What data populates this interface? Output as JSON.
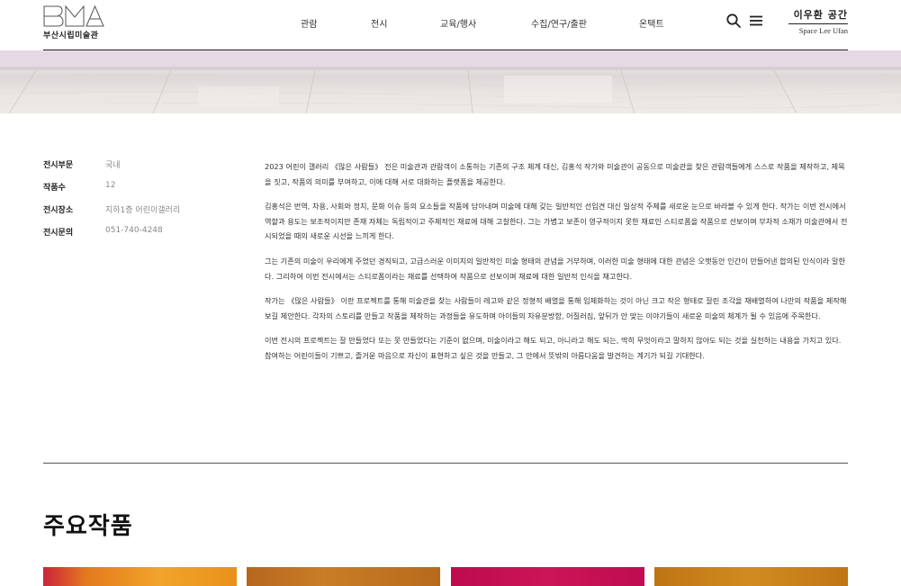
{
  "header": {
    "logo_text": "부산시립미술관",
    "logo_mark_letters": "BMA",
    "nav": [
      "관람",
      "전시",
      "교육/행사",
      "수집/연구/출판",
      "온택트"
    ],
    "search_icon": "search-icon",
    "menu_icon": "hamburger-menu-icon",
    "space_link_ko": "이우환 공간",
    "space_link_en": "Space Lee Ufan"
  },
  "exhibition_info": [
    {
      "label": "전시부문",
      "value": "국내"
    },
    {
      "label": "작품수",
      "value": "12"
    },
    {
      "label": "전시장소",
      "value": "지하1층 어린이갤러리"
    },
    {
      "label": "전시문의",
      "value": "051-740-4248"
    }
  ],
  "description": [
    "2023 어린이 갤러리 《많은 사람들》 전은 미술관과 관람객이 소통하는 기존의 구조 체계 대신, 김홍석 작가와 미술관이 공동으로 미술관을 찾은 관람객들에게 스스로 작품을 제작하고, 제목을 짓고, 작품의 의미를 부여하고, 이에 대해 서로 대화하는 플랫폼을 제공한다.",
    "김홍석은 번역, 차용, 사회와 정치, 문화 이슈 등의 요소들을 작품에 담아내며 미술에 대해 갖는 일반적인 선입견 대신 일상적 주제를 새로운 눈으로 바라볼 수 있게 한다. 작가는 이번 전시에서 역할과 용도는 보조적이지만 존재 자체는 독립적이고 주체적인 재료에 대해 고찰한다. 그는 가볍고 보존이 영구적이지 못한 재료인 스티로폼을 작품으로 선보이며 부차적 소재가 미술관에서 전시되었을 때의 새로운 시선을 느끼게 한다.",
    "그는 기존의 미술이 우리에게 주었던 경직되고, 고급스러운 이미지의 일반적인 미술 형태의 관념을 거부하며, 이러한 미술 형태에 대한 관념은 오랫동안 인간이 만들어낸 합의된 인식이라 말한다. 그리하여 이번 전시에서는 스티로폼이라는 재료를 선택하여 작품으로 선보이며 재료에 대한 일반적 인식을 재고한다.",
    "작가는 《많은 사람들》 이란 프로젝트를 통해 미술관을 찾는 사람들이 레고와 같은 정형적 배열을 통해 입체화하는 것이 아닌 크고 작은 형태로 잘린 조각을 재배열하여 나만의 작품을 제작해보길 제안한다. 각자의 스토리를 만들고 작품을 제작하는 과정들을 유도하며 아이들의 자유분방함, 어질러짐, 앞뒤가 안 맞는 이야기들이 새로운 미술의 체계가 될 수 있음에 주목한다.",
    "이번 전시의 프로젝트는 잘 만들었다 또는 못 만들었다는 기준이 없으며, 미술이라고 해도 되고, 아니라고 해도 되는, 딱히 무엇이라고 말하지 않아도 되는 것을 실천하는 내용을 가지고 있다. 참여하는 어린이들이 기쁘고, 즐거운 마음으로 자신이 표현하고 싶은 것을 만들고, 그 안에서 뜻밖의 아름다움을 발견하는 계기가 되길 기대한다."
  ],
  "section": {
    "title": "주요작품"
  },
  "colors": {
    "accent_text": "#222222",
    "muted_text": "#8a8a8a",
    "thumb_1": "#f1a42a",
    "thumb_2": "#c97d26",
    "thumb_3": "#cc1457",
    "thumb_4": "#d18b1f"
  }
}
